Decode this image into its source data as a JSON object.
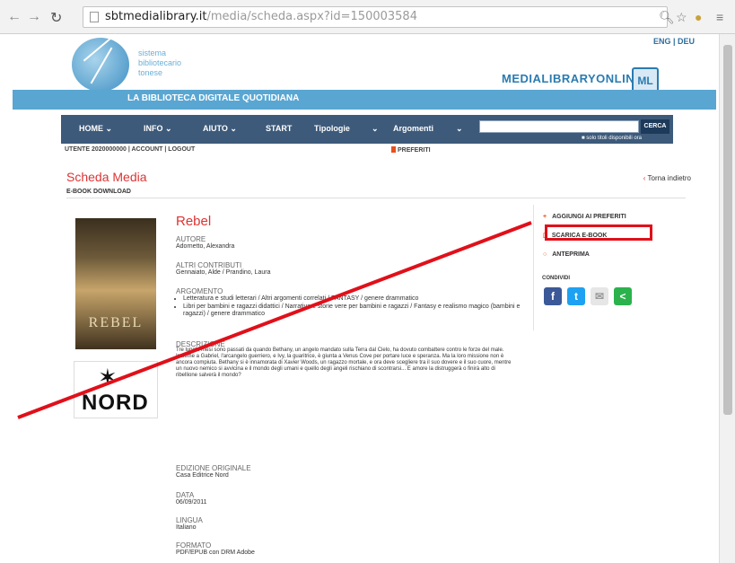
{
  "browser": {
    "url_host": "sbtmedialibrary.it",
    "url_path": "/media/scheda.aspx?id=150003584"
  },
  "site": {
    "lang": "ENG | DEU",
    "logo_text": [
      "sistema",
      "bibliotecario",
      "tonese"
    ],
    "brand": "MEDIALIBRARYONLINE",
    "brand_box": "ML",
    "tagline": "LA BIBLIOTECA DIGITALE QUOTIDIANA"
  },
  "nav": {
    "items": [
      "HOME ⌄",
      "INFO ⌄",
      "AIUTO ⌄",
      "START",
      "Tipologie",
      "⌄",
      "Argomenti",
      "⌄"
    ],
    "search_button": "CERCA",
    "search_note": "solo titoli disponibili ora"
  },
  "userbar": {
    "text": "UTENTE 2020000000 | ACCOUNT | LOGOUT",
    "preferiti": "PREFERITI"
  },
  "page": {
    "title": "Scheda Media",
    "back": "Torna indietro",
    "subtitle": "E-BOOK DOWNLOAD"
  },
  "book": {
    "cover_title": "REBEL",
    "publisher_logo": "NORD",
    "title": "Rebel",
    "author_label": "AUTORE",
    "author": "Adornetto, Alexandra",
    "contrib_label": "ALTRI CONTRIBUTI",
    "contrib": "Gennaiato, Alde / Prandino, Laura",
    "arg_label": "ARGOMENTO",
    "args": [
      "Letteratura e studi letterari / Altri argomenti correlati / FANTASY / genere drammatico",
      "Libri per bambini e ragazzi didattici / Narrativa e storie vere per bambini e ragazzi / Fantasy e realismo magico (bambini e ragazzi) / genere drammatico"
    ],
    "desc_label": "DESCRIZIONE",
    "description": "Tre lunghi mesi sono passati da quando Bethany, un angelo mandato sulla Terra dal Cielo, ha dovuto combattere contro le forze del male. Insieme a Gabriel, l'arcangelo guerriero, e Ivy, la guaritrice, è giunta a Venus Cove per portare luce e speranza. Ma la loro missione non è ancora compiuta. Bethany si è innamorata di Xavier Woods, un ragazzo mortale, e ora deve scegliere tra il suo dovere e il suo cuore, mentre un nuovo nemico si avvicina e il mondo degli umani e quello degli angeli rischiano di scontrarsi... E amore la distruggerà o finirà alto di ribellione salverà il mondo?",
    "edition_label": "EDIZIONE ORIGINALE",
    "edition": "Casa Editrice Nord",
    "date_label": "DATA",
    "date": "06/09/2011",
    "lang_label": "LINGUA",
    "lang": "Italiano",
    "format_label": "FORMATO",
    "format": "PDF/EPUB con DRM Adobe"
  },
  "sidebar": {
    "add_fav": "AGGIUNGI AI PREFERITI",
    "download": "SCARICA E-BOOK",
    "preview": "ANTEPRIMA",
    "share_label": "CONDIVIDI"
  },
  "colors": {
    "accent_red": "#e0101a",
    "nav_blue": "#3d5a7a",
    "banner_blue": "#5aa6d2"
  }
}
